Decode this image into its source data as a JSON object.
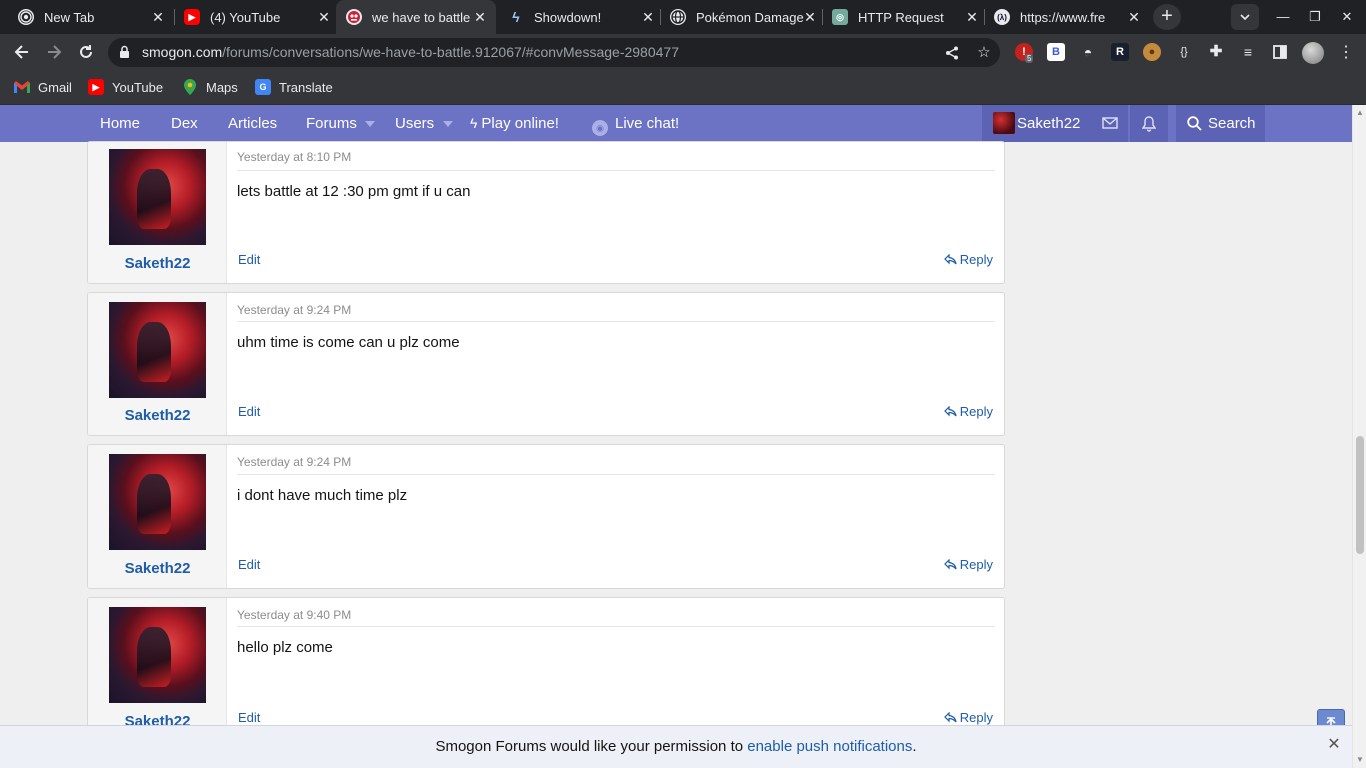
{
  "tabs": [
    {
      "title": "New Tab",
      "icon": "chrome-icon"
    },
    {
      "title": "(4) YouTube",
      "icon": "youtube-icon"
    },
    {
      "title": "we have to battle",
      "icon": "smogon-icon"
    },
    {
      "title": "Showdown!",
      "icon": "showdown-icon"
    },
    {
      "title": "Pokémon Damage",
      "icon": "globe-icon"
    },
    {
      "title": "HTTP Request",
      "icon": "openai-icon"
    },
    {
      "title": "https://www.fre",
      "icon": "freecodecamp-icon"
    }
  ],
  "omnibox": {
    "host": "smogon.com",
    "path": "/forums/conversations/we-have-to-battle.912067/#convMessage-2980477"
  },
  "extensions": {
    "badge_count": "5",
    "b_label": "B",
    "r_label": "R",
    "braces_label": "{}"
  },
  "bookmarks": [
    {
      "label": "Gmail",
      "icon": "gmail-icon"
    },
    {
      "label": "YouTube",
      "icon": "youtube-icon"
    },
    {
      "label": "Maps",
      "icon": "maps-icon"
    },
    {
      "label": "Translate",
      "icon": "translate-icon"
    }
  ],
  "sitenav": {
    "home": "Home",
    "dex": "Dex",
    "articles": "Articles",
    "forums": "Forums",
    "users": "Users",
    "play_online": "Play online!",
    "live_chat": "Live chat!",
    "username": "Saketh22",
    "search": "Search"
  },
  "posts": [
    {
      "time": "Yesterday at 8:10 PM",
      "message": "lets battle at 12 :30 pm gmt if u can",
      "author": "Saketh22",
      "edit": "Edit",
      "reply": "Reply"
    },
    {
      "time": "Yesterday at 9:24 PM",
      "message": "uhm time is come can u plz come",
      "author": "Saketh22",
      "edit": "Edit",
      "reply": "Reply"
    },
    {
      "time": "Yesterday at 9:24 PM",
      "message": "i dont have much time plz",
      "author": "Saketh22",
      "edit": "Edit",
      "reply": "Reply"
    },
    {
      "time": "Yesterday at 9:40 PM",
      "message": "hello plz come",
      "author": "Saketh22",
      "edit": "Edit",
      "reply": "Reply"
    }
  ],
  "push_notice": {
    "prefix": "Smogon Forums would like your permission to ",
    "link": "enable push notifications",
    "suffix": "."
  },
  "colors": {
    "nav_bg": "#6c72c4",
    "link": "#1f5da8",
    "browser_dark": "#202124"
  }
}
